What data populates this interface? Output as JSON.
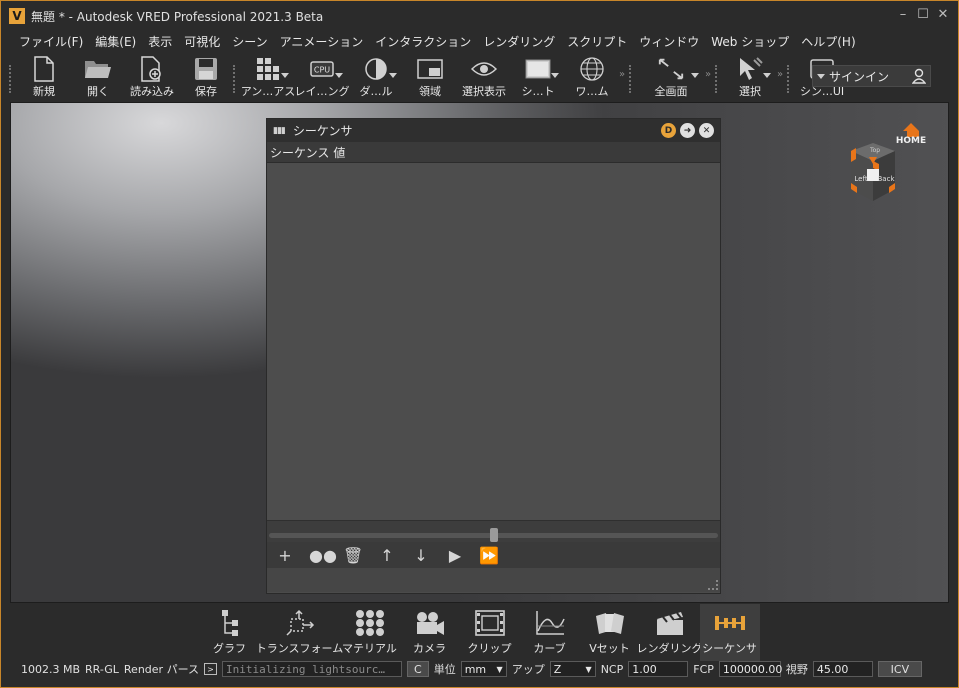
{
  "window": {
    "title": "無題 * - Autodesk VRED Professional 2021.3 Beta",
    "logo_letter": "V"
  },
  "menu": [
    "ファイル(F)",
    "編集(E)",
    "表示",
    "可視化",
    "シーン",
    "アニメーション",
    "インタラクション",
    "レンダリング",
    "スクリプト",
    "ウィンドウ",
    "Web ショップ",
    "ヘルプ(H)"
  ],
  "toolbar": {
    "new": "新規",
    "open": "開く",
    "import": "読み込み",
    "save": "保存",
    "antialias": "アン…アス",
    "raytracing": "レイ…ング",
    "darkwall": "ダ…ル",
    "region": "領域",
    "selection_display": "選択表示",
    "sheet": "シ…ト",
    "wireframe": "ワ…ム",
    "fullscreen": "全画面",
    "select": "選択",
    "scene_ui": "シン…UI",
    "cpu_badge": "CPU",
    "ui_badge": "UI"
  },
  "signin": {
    "label": "サインイン"
  },
  "sequencer": {
    "title": "シーケンサ",
    "columns": [
      "シーケンス",
      "値"
    ],
    "badge_d": "D"
  },
  "viewcube": {
    "home": "HOME",
    "left": "Left",
    "back": "Back",
    "top": "Top"
  },
  "modules": [
    "グラフ",
    "トランスフォーム",
    "マテリアル",
    "カメラ",
    "クリップ",
    "カーブ",
    "Vセット",
    "レンダリング",
    "シーケンサ"
  ],
  "status": {
    "memory": "1002.3 MB",
    "renderer": "RR-GL",
    "render_pass": "Render パース",
    "log": "Initializing lightsourc…",
    "c_btn": "C",
    "unit_label": "単位",
    "unit_value": "mm",
    "up_label": "アップ",
    "up_value": "Z",
    "ncp_label": "NCP",
    "ncp_value": "1.00",
    "fcp_label": "FCP",
    "fcp_value": "100000.00",
    "fov_label": "視野",
    "fov_value": "45.00",
    "icv": "ICV"
  }
}
